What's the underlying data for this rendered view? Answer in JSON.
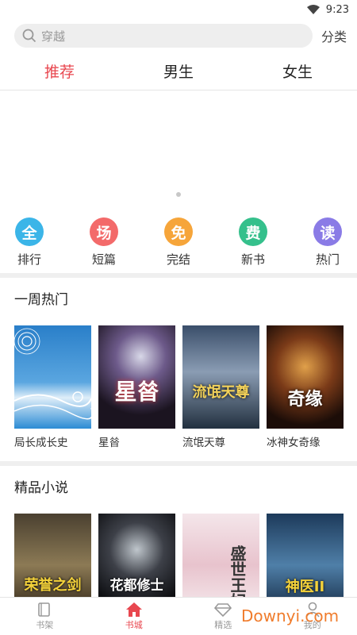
{
  "status": {
    "time": "9:23"
  },
  "search": {
    "placeholder": "穿越",
    "category_label": "分类"
  },
  "tabs": [
    {
      "label": "推荐",
      "active": true
    },
    {
      "label": "男生",
      "active": false
    },
    {
      "label": "女生",
      "active": false
    }
  ],
  "quick": [
    {
      "glyph": "全",
      "label": "排行",
      "color": "#3bb5e8"
    },
    {
      "glyph": "场",
      "label": "短篇",
      "color": "#f36a6a"
    },
    {
      "glyph": "免",
      "label": "完结",
      "color": "#f6a53a"
    },
    {
      "glyph": "费",
      "label": "新书",
      "color": "#35c08c"
    },
    {
      "glyph": "读",
      "label": "热门",
      "color": "#8a7be6"
    }
  ],
  "sections": [
    {
      "title": "一周热门",
      "books": [
        {
          "title": "局长成长史"
        },
        {
          "title": "星㫺",
          "cover_text": "星㫺"
        },
        {
          "title": "流氓天尊",
          "cover_text": "流氓天尊"
        },
        {
          "title": "冰神女奇缘",
          "cover_text": "奇缘"
        }
      ]
    },
    {
      "title": "精品小说",
      "books": [
        {
          "title": "",
          "cover_text": "荣誉之剑"
        },
        {
          "title": "",
          "cover_text": "花都修士"
        },
        {
          "title": "",
          "cover_text": "盛世王妃"
        },
        {
          "title": "",
          "cover_text": "神医II"
        }
      ]
    }
  ],
  "bottom_nav": [
    {
      "label": "书架",
      "icon": "book-icon",
      "active": false
    },
    {
      "label": "书城",
      "icon": "home-icon",
      "active": true
    },
    {
      "label": "精选",
      "icon": "diamond-icon",
      "active": false
    },
    {
      "label": "我的",
      "icon": "user-icon",
      "active": false
    }
  ],
  "watermark": "Downyi.com"
}
